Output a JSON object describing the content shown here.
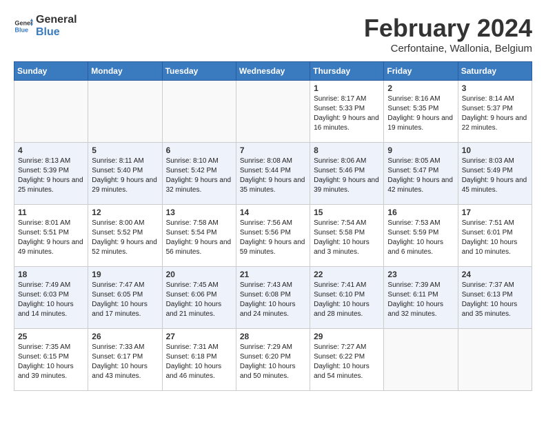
{
  "header": {
    "logo_general": "General",
    "logo_blue": "Blue",
    "month_title": "February 2024",
    "subtitle": "Cerfontaine, Wallonia, Belgium"
  },
  "days_of_week": [
    "Sunday",
    "Monday",
    "Tuesday",
    "Wednesday",
    "Thursday",
    "Friday",
    "Saturday"
  ],
  "weeks": [
    [
      {
        "day": "",
        "info": ""
      },
      {
        "day": "",
        "info": ""
      },
      {
        "day": "",
        "info": ""
      },
      {
        "day": "",
        "info": ""
      },
      {
        "day": "1",
        "info": "Sunrise: 8:17 AM\nSunset: 5:33 PM\nDaylight: 9 hours\nand 16 minutes."
      },
      {
        "day": "2",
        "info": "Sunrise: 8:16 AM\nSunset: 5:35 PM\nDaylight: 9 hours\nand 19 minutes."
      },
      {
        "day": "3",
        "info": "Sunrise: 8:14 AM\nSunset: 5:37 PM\nDaylight: 9 hours\nand 22 minutes."
      }
    ],
    [
      {
        "day": "4",
        "info": "Sunrise: 8:13 AM\nSunset: 5:39 PM\nDaylight: 9 hours\nand 25 minutes."
      },
      {
        "day": "5",
        "info": "Sunrise: 8:11 AM\nSunset: 5:40 PM\nDaylight: 9 hours\nand 29 minutes."
      },
      {
        "day": "6",
        "info": "Sunrise: 8:10 AM\nSunset: 5:42 PM\nDaylight: 9 hours\nand 32 minutes."
      },
      {
        "day": "7",
        "info": "Sunrise: 8:08 AM\nSunset: 5:44 PM\nDaylight: 9 hours\nand 35 minutes."
      },
      {
        "day": "8",
        "info": "Sunrise: 8:06 AM\nSunset: 5:46 PM\nDaylight: 9 hours\nand 39 minutes."
      },
      {
        "day": "9",
        "info": "Sunrise: 8:05 AM\nSunset: 5:47 PM\nDaylight: 9 hours\nand 42 minutes."
      },
      {
        "day": "10",
        "info": "Sunrise: 8:03 AM\nSunset: 5:49 PM\nDaylight: 9 hours\nand 45 minutes."
      }
    ],
    [
      {
        "day": "11",
        "info": "Sunrise: 8:01 AM\nSunset: 5:51 PM\nDaylight: 9 hours\nand 49 minutes."
      },
      {
        "day": "12",
        "info": "Sunrise: 8:00 AM\nSunset: 5:52 PM\nDaylight: 9 hours\nand 52 minutes."
      },
      {
        "day": "13",
        "info": "Sunrise: 7:58 AM\nSunset: 5:54 PM\nDaylight: 9 hours\nand 56 minutes."
      },
      {
        "day": "14",
        "info": "Sunrise: 7:56 AM\nSunset: 5:56 PM\nDaylight: 9 hours\nand 59 minutes."
      },
      {
        "day": "15",
        "info": "Sunrise: 7:54 AM\nSunset: 5:58 PM\nDaylight: 10 hours\nand 3 minutes."
      },
      {
        "day": "16",
        "info": "Sunrise: 7:53 AM\nSunset: 5:59 PM\nDaylight: 10 hours\nand 6 minutes."
      },
      {
        "day": "17",
        "info": "Sunrise: 7:51 AM\nSunset: 6:01 PM\nDaylight: 10 hours\nand 10 minutes."
      }
    ],
    [
      {
        "day": "18",
        "info": "Sunrise: 7:49 AM\nSunset: 6:03 PM\nDaylight: 10 hours\nand 14 minutes."
      },
      {
        "day": "19",
        "info": "Sunrise: 7:47 AM\nSunset: 6:05 PM\nDaylight: 10 hours\nand 17 minutes."
      },
      {
        "day": "20",
        "info": "Sunrise: 7:45 AM\nSunset: 6:06 PM\nDaylight: 10 hours\nand 21 minutes."
      },
      {
        "day": "21",
        "info": "Sunrise: 7:43 AM\nSunset: 6:08 PM\nDaylight: 10 hours\nand 24 minutes."
      },
      {
        "day": "22",
        "info": "Sunrise: 7:41 AM\nSunset: 6:10 PM\nDaylight: 10 hours\nand 28 minutes."
      },
      {
        "day": "23",
        "info": "Sunrise: 7:39 AM\nSunset: 6:11 PM\nDaylight: 10 hours\nand 32 minutes."
      },
      {
        "day": "24",
        "info": "Sunrise: 7:37 AM\nSunset: 6:13 PM\nDaylight: 10 hours\nand 35 minutes."
      }
    ],
    [
      {
        "day": "25",
        "info": "Sunrise: 7:35 AM\nSunset: 6:15 PM\nDaylight: 10 hours\nand 39 minutes."
      },
      {
        "day": "26",
        "info": "Sunrise: 7:33 AM\nSunset: 6:17 PM\nDaylight: 10 hours\nand 43 minutes."
      },
      {
        "day": "27",
        "info": "Sunrise: 7:31 AM\nSunset: 6:18 PM\nDaylight: 10 hours\nand 46 minutes."
      },
      {
        "day": "28",
        "info": "Sunrise: 7:29 AM\nSunset: 6:20 PM\nDaylight: 10 hours\nand 50 minutes."
      },
      {
        "day": "29",
        "info": "Sunrise: 7:27 AM\nSunset: 6:22 PM\nDaylight: 10 hours\nand 54 minutes."
      },
      {
        "day": "",
        "info": ""
      },
      {
        "day": "",
        "info": ""
      }
    ]
  ]
}
